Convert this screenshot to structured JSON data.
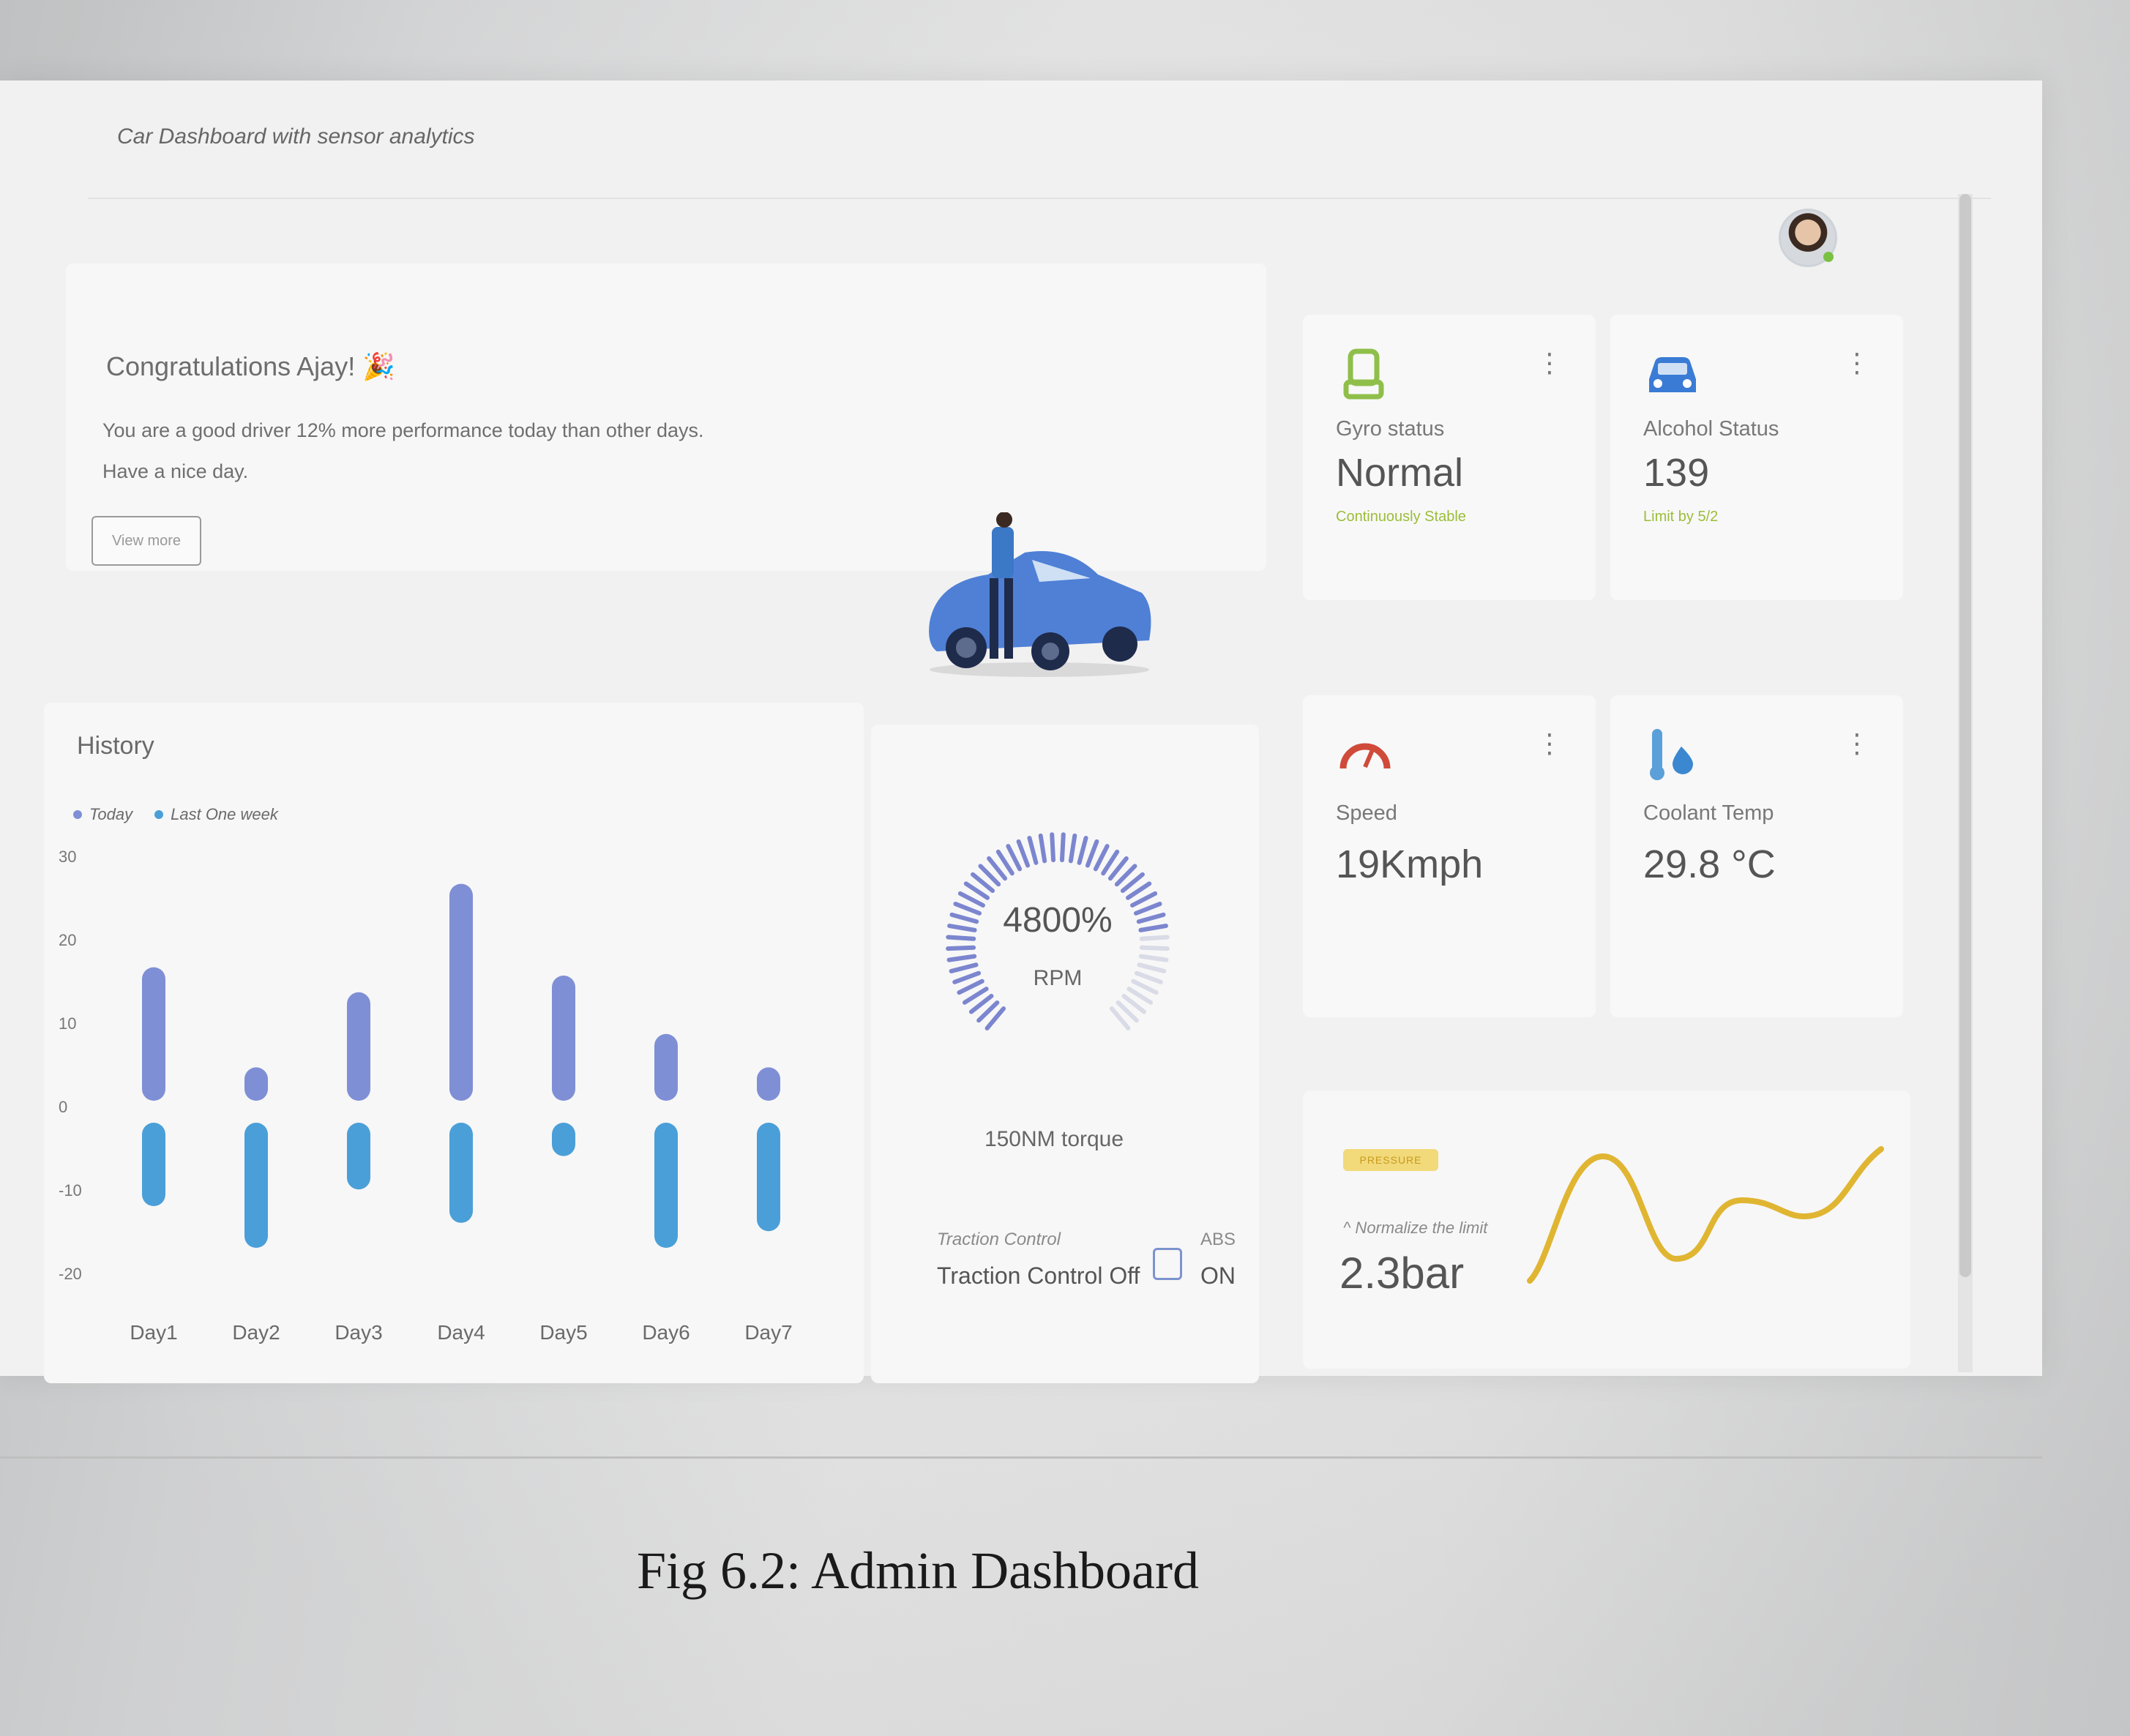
{
  "app": {
    "title": "Car Dashboard with sensor analytics"
  },
  "welcome": {
    "title": "Congratulations Ajay! 🎉",
    "message": "You are a good driver 12% more performance today than other days.",
    "message2": "Have a nice day.",
    "button_label": "View more"
  },
  "stats": {
    "gyro": {
      "label": "Gyro status",
      "value": "Normal",
      "sub": "Continuously Stable",
      "icon": "seat-icon"
    },
    "alcohol": {
      "label": "Alcohol Status",
      "value": "139",
      "sub": "Limit by 5/2",
      "icon": "car-icon"
    },
    "speed": {
      "label": "Speed",
      "value": "19Kmph",
      "icon": "speedometer-icon"
    },
    "coolant": {
      "label": "Coolant Temp",
      "value": "29.8 °C",
      "icon": "thermometer-icon"
    }
  },
  "history": {
    "title": "History",
    "legend": [
      "Today",
      "Last One week"
    ]
  },
  "engine": {
    "rpm_value": "4800%",
    "rpm_unit": "RPM",
    "rpm_fraction": 0.8,
    "torque": "150NM torque",
    "traction_label": "Traction Control",
    "traction_value": "Traction Control Off",
    "abs_label": "ABS",
    "abs_value": "ON"
  },
  "pressure": {
    "badge": "PRESSURE",
    "normalize": "^ Normalize the limit",
    "value": "2.3bar"
  },
  "caption": "Fig 6.2: Admin Dashboard",
  "colors": {
    "today": "#7f8fd6",
    "last_week": "#4a9fd8",
    "accent_green": "#9bbd3a",
    "pressure_line": "#e0b531",
    "gauge": "#7c86cf"
  },
  "chart_data": {
    "type": "bar",
    "categories": [
      "Day1",
      "Day2",
      "Day3",
      "Day4",
      "Day5",
      "Day6",
      "Day7"
    ],
    "series": [
      {
        "name": "Today",
        "values": [
          16,
          4,
          13,
          26,
          15,
          8,
          4
        ]
      },
      {
        "name": "Last One week",
        "values": [
          -10,
          -15,
          -8,
          -12,
          -4,
          -15,
          -13
        ]
      }
    ],
    "yticks": [
      30,
      20,
      10,
      0,
      -10,
      -20
    ],
    "ylim": [
      -20,
      30
    ],
    "legend": "top-left"
  }
}
